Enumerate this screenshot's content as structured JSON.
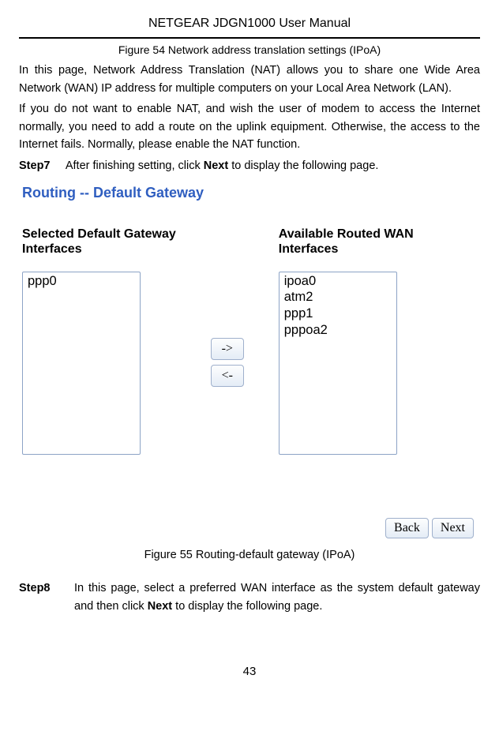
{
  "doc_title": "NETGEAR JDGN1000 User Manual",
  "figure54_caption": "Figure 54 Network address translation settings (IPoA)",
  "para1": "In this page, Network Address Translation (NAT) allows you to share one Wide Area Network (WAN) IP address for multiple computers on your Local Area Network (LAN).",
  "para2": "If you do not want to enable NAT, and wish the user of modem to access the Internet normally, you need to add a route on the uplink equipment. Otherwise, the access to the Internet fails. Normally, please enable the NAT function.",
  "step7_label": "Step7",
  "step7_pre": "After finishing setting, click ",
  "step7_bold": "Next",
  "step7_post": " to display the following page.",
  "router_heading": "Routing -- Default Gateway",
  "left_label_l1": "Selected Default Gateway",
  "left_label_l2": "Interfaces",
  "right_label_l1": "Available Routed WAN",
  "right_label_l2": "Interfaces",
  "left_items": [
    "ppp0"
  ],
  "right_items": [
    "ipoa0",
    "atm2",
    "ppp1",
    "pppoa2"
  ],
  "btn_right": "->",
  "btn_left": "<-",
  "btn_back": "Back",
  "btn_next": "Next",
  "figure55_caption": "Figure 55 Routing-default gateway (IPoA)",
  "step8_label": "Step8",
  "step8_pre": "In this page, select a preferred WAN interface as the system default gateway and then click ",
  "step8_bold": "Next",
  "step8_post": " to display the following page.",
  "page_number": "43"
}
